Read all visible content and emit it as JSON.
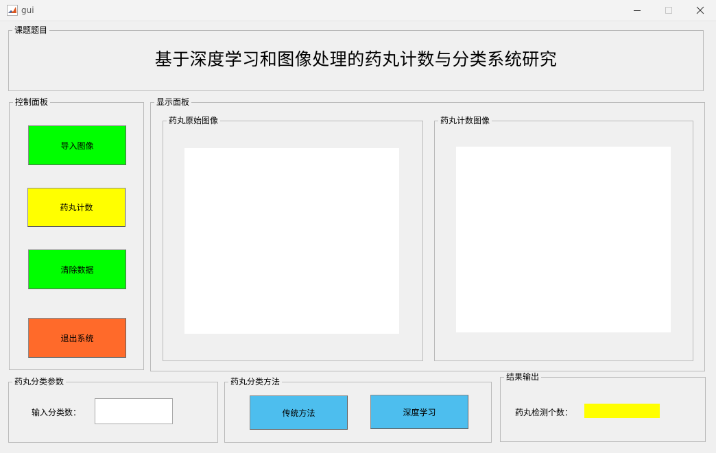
{
  "window": {
    "title": "gui"
  },
  "title_panel": {
    "legend": "课题题目",
    "heading": "基于深度学习和图像处理的药丸计数与分类系统研究"
  },
  "control_panel": {
    "legend": "控制面板",
    "buttons": [
      {
        "label": "导入图像",
        "color": "#00ff00"
      },
      {
        "label": "药丸计数",
        "color": "#ffff00"
      },
      {
        "label": "清除数据",
        "color": "#00ff00"
      },
      {
        "label": "退出系统",
        "color": "#ff6a2a"
      }
    ]
  },
  "display_panel": {
    "legend": "显示面板",
    "original_image": {
      "legend": "药丸原始图像"
    },
    "count_image": {
      "legend": "药丸计数图像"
    }
  },
  "params_panel": {
    "legend": "药丸分类参数",
    "input_label": "输入分类数：",
    "input_value": ""
  },
  "method_panel": {
    "legend": "药丸分类方法",
    "buttons": [
      {
        "label": "传统方法",
        "color": "#4dbeee"
      },
      {
        "label": "深度学习",
        "color": "#4dbeee"
      }
    ]
  },
  "result_panel": {
    "legend": "结果输出",
    "count_label": "药丸检测个数：",
    "count_value": "",
    "count_bg": "#ffff00"
  }
}
